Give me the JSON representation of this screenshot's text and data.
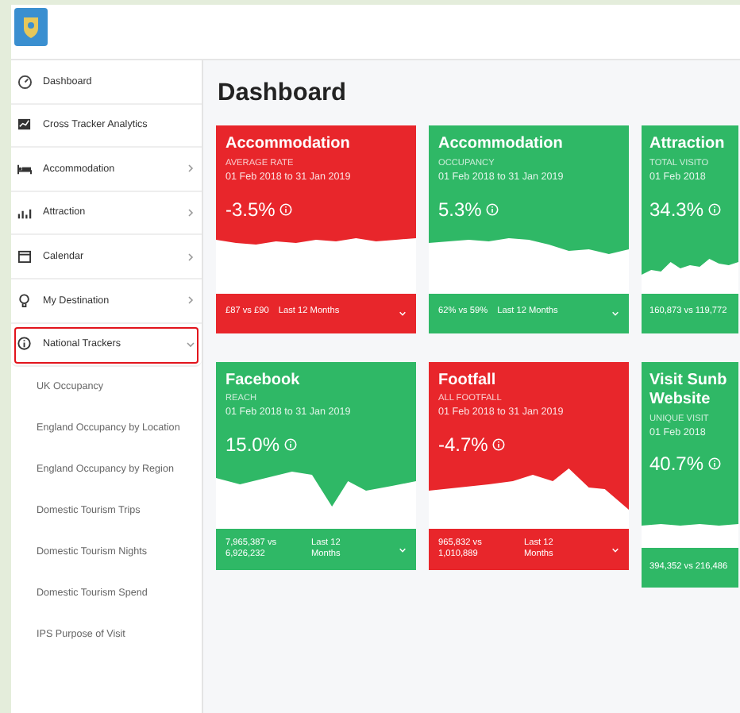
{
  "sidebar": {
    "items": [
      {
        "label": "Dashboard"
      },
      {
        "label": "Cross Tracker Analytics"
      },
      {
        "label": "Accommodation",
        "expanded": false
      },
      {
        "label": "Attraction",
        "expanded": false
      },
      {
        "label": "Calendar",
        "expanded": false
      },
      {
        "label": "My Destination",
        "expanded": false
      },
      {
        "label": "National Trackers",
        "expanded": true,
        "highlighted": true,
        "children": [
          {
            "label": "UK Occupancy"
          },
          {
            "label": "England Occupancy by Location"
          },
          {
            "label": "England Occupancy by Region"
          },
          {
            "label": "Domestic Tourism Trips"
          },
          {
            "label": "Domestic Tourism Nights"
          },
          {
            "label": "Domestic Tourism Spend"
          },
          {
            "label": "IPS Purpose of Visit"
          }
        ]
      }
    ]
  },
  "main": {
    "title": "Dashboard",
    "cards": [
      {
        "title": "Accommodation",
        "subtitle": "AVERAGE RATE",
        "dates": "01 Feb 2018 to 31 Jan 2019",
        "value": "-3.5%",
        "color": "#e8262b",
        "comparison": "£87 vs £90",
        "period": "Last 12 Months"
      },
      {
        "title": "Accommodation",
        "subtitle": "OCCUPANCY",
        "dates": "01 Feb 2018 to 31 Jan 2019",
        "value": "5.3%",
        "color": "#2fb866",
        "comparison": "62% vs 59%",
        "period": "Last 12 Months"
      },
      {
        "title": "Attraction",
        "subtitle": "TOTAL VISITO",
        "dates": "01 Feb 2018",
        "value": "34.3%",
        "color": "#2fb866",
        "comparison": "160,873 vs 119,772"
      },
      {
        "title": "Facebook",
        "subtitle": "REACH",
        "dates": "01 Feb 2018 to 31 Jan 2019",
        "value": "15.0%",
        "color": "#2fb866",
        "comparison": "7,965,387 vs 6,926,232",
        "period": "Last 12 Months"
      },
      {
        "title": "Footfall",
        "subtitle": "ALL FOOTFALL",
        "dates": "01 Feb 2018 to 31 Jan 2019",
        "value": "-4.7%",
        "color": "#e8262b",
        "comparison": "965,832 vs 1,010,889",
        "period": "Last 12 Months"
      },
      {
        "title": "Visit Sunb Website",
        "subtitle": "UNIQUE VISIT",
        "dates": "01 Feb 2018",
        "value": "40.7%",
        "color": "#2fb866",
        "comparison": "394,352 vs 216,486"
      }
    ]
  }
}
